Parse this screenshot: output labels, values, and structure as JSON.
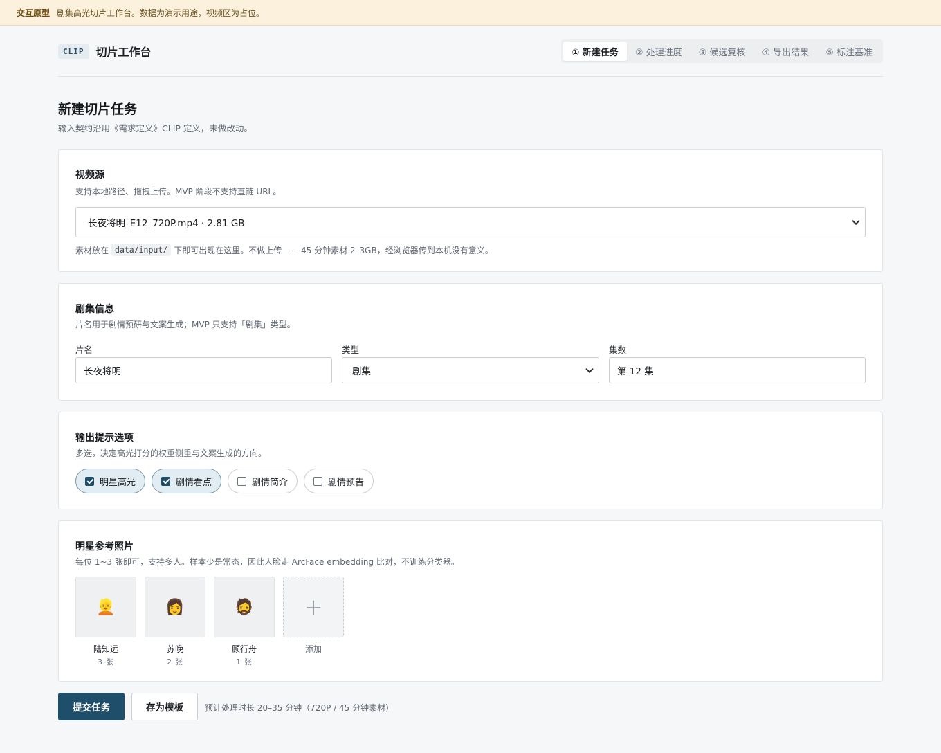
{
  "banner": {
    "tag": "交互原型",
    "text": "剧集高光切片工作台。数据为演示用途，视频区为占位。"
  },
  "header": {
    "chip": "CLIP",
    "title": "切片工作台",
    "steps": [
      {
        "label": "① 新建任务",
        "active": true
      },
      {
        "label": "② 处理进度",
        "active": false
      },
      {
        "label": "③ 候选复核",
        "active": false
      },
      {
        "label": "④ 导出结果",
        "active": false
      },
      {
        "label": "⑤ 标注基准",
        "active": false
      }
    ]
  },
  "page": {
    "title": "新建切片任务",
    "subtitle": "输入契约沿用《需求定义》CLIP 定义，未做改动。"
  },
  "video_source": {
    "title": "视频源",
    "subtitle": "支持本地路径、拖拽上传。MVP 阶段不支持直链 URL。",
    "selected": "长夜将明_E12_720P.mp4 · 2.81 GB",
    "hint_before": "素材放在",
    "hint_code": "data/input/",
    "hint_after": "下即可出现在这里。不做上传—— 45 分钟素材 2–3GB，经浏览器传到本机没有意义。"
  },
  "series_info": {
    "title": "剧集信息",
    "subtitle": "片名用于剧情预研与文案生成；MVP 只支持「剧集」类型。",
    "name_label": "片名",
    "name_value": "长夜将明",
    "type_label": "类型",
    "type_value": "剧集",
    "episode_label": "集数",
    "episode_value": "第 12 集"
  },
  "output_options": {
    "title": "输出提示选项",
    "subtitle": "多选，决定高光打分的权重侧重与文案生成的方向。",
    "options": [
      {
        "label": "明星高光",
        "checked": true
      },
      {
        "label": "剧情看点",
        "checked": true
      },
      {
        "label": "剧情简介",
        "checked": false
      },
      {
        "label": "剧情预告",
        "checked": false
      }
    ]
  },
  "star_photos": {
    "title": "明星参考照片",
    "subtitle": "每位 1~3 张即可，支持多人。样本少是常态，因此人脸走 ArcFace embedding 比对，不训练分类器。",
    "stars": [
      {
        "emoji": "👱",
        "name": "陆知远",
        "count": "3 张"
      },
      {
        "emoji": "👩",
        "name": "苏晚",
        "count": "2 张"
      },
      {
        "emoji": "🧔",
        "name": "顾行舟",
        "count": "1 张"
      }
    ],
    "add_symbol": "+",
    "add_label": "添加"
  },
  "actions": {
    "submit": "提交任务",
    "save_template": "存为模板",
    "estimate": "预计处理时长 20–35 分钟（720P / 45 分钟素材）"
  }
}
